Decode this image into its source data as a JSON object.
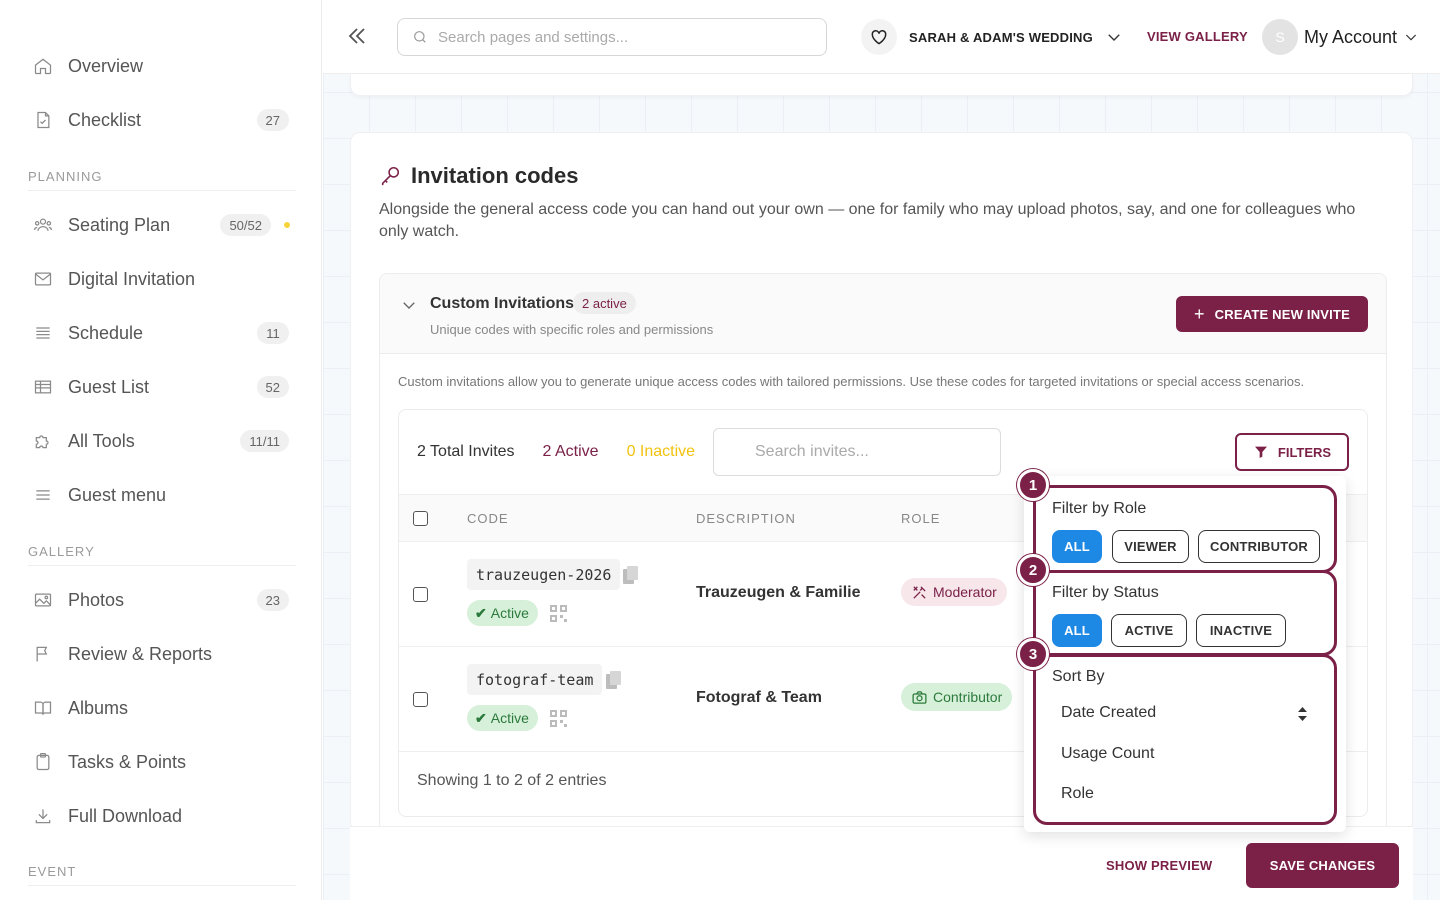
{
  "sidebar": {
    "items": [
      {
        "label": "Overview",
        "icon": "home-icon"
      },
      {
        "label": "Checklist",
        "icon": "checklist-icon",
        "badge": "27"
      },
      {
        "label": "Seating Plan",
        "icon": "people-icon",
        "badge": "50/52",
        "dot_color": "#f5d33b"
      },
      {
        "label": "Digital Invitation",
        "icon": "mail-icon"
      },
      {
        "label": "Schedule",
        "icon": "list-icon",
        "badge": "11"
      },
      {
        "label": "Guest List",
        "icon": "table-icon",
        "badge": "52"
      },
      {
        "label": "All Tools",
        "icon": "puzzle-icon",
        "badge": "11/11"
      },
      {
        "label": "Guest menu",
        "icon": "menu-icon"
      },
      {
        "label": "Photos",
        "icon": "image-icon",
        "badge": "23"
      },
      {
        "label": "Review & Reports",
        "icon": "flag-icon"
      },
      {
        "label": "Albums",
        "icon": "book-icon"
      },
      {
        "label": "Tasks & Points",
        "icon": "clipboard-icon"
      },
      {
        "label": "Full Download",
        "icon": "download-icon"
      }
    ],
    "sections": {
      "planning": "PLANNING",
      "gallery": "GALLERY",
      "event": "EVENT"
    }
  },
  "topbar": {
    "search_placeholder": "Search pages and settings...",
    "wedding_name": "SARAH & ADAM'S WEDDING",
    "view_gallery": "VIEW GALLERY",
    "avatar_initial": "S",
    "account_label": "My Account"
  },
  "invitation_codes": {
    "title": "Invitation codes",
    "description": "Alongside the general access code you can hand out your own — one for family who may upload photos, say, and one for colleagues who only watch."
  },
  "custom": {
    "title": "Custom Invitations",
    "active_pill": "2 active",
    "subtitle": "Unique codes with specific roles and permissions",
    "create_button": "CREATE NEW INVITE",
    "info": "Custom invitations allow you to generate unique access codes with tailored permissions. Use these codes for targeted invitations or special access scenarios."
  },
  "table": {
    "total": "2 Total Invites",
    "active": "2 Active",
    "inactive": "0 Inactive",
    "search_placeholder": "Search invites...",
    "filters_button": "FILTERS",
    "columns": [
      "CODE",
      "DESCRIPTION",
      "ROLE"
    ],
    "rows": [
      {
        "code": "trauzeugen-2026",
        "status": "Active",
        "description": "Trauzeugen & Familie",
        "role": "Moderator"
      },
      {
        "code": "fotograf-team",
        "status": "Active",
        "description": "Fotograf & Team",
        "role": "Contributor"
      }
    ],
    "showing": "Showing 1 to 2 of 2 entries"
  },
  "filters": {
    "steps": [
      "1",
      "2",
      "3"
    ],
    "role_label": "Filter by Role",
    "role_options": [
      "ALL",
      "VIEWER",
      "CONTRIBUTOR"
    ],
    "status_label": "Filter by Status",
    "status_options": [
      "ALL",
      "ACTIVE",
      "INACTIVE"
    ],
    "sort_label": "Sort By",
    "sort_options": [
      "Date Created",
      "Usage Count",
      "Role"
    ]
  },
  "actions": {
    "show_preview": "SHOW PREVIEW",
    "save_changes": "SAVE CHANGES"
  },
  "colors": {
    "brand": "#7b2148",
    "selected_chip": "#1e88e5",
    "success_bg": "#d6f0da",
    "inactive": "#f2c30f"
  }
}
